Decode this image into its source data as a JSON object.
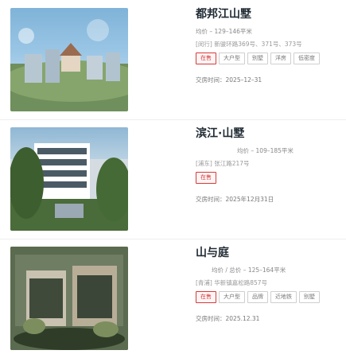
{
  "listings": [
    {
      "title": "都邦江山墅",
      "price_label": "均价",
      "price_value": "– 129–146平米",
      "address": "[闵行] 新骏环路369号、371号、373号",
      "tags": [
        "在售",
        "大户型",
        "别墅",
        "洋房",
        "低密度"
      ],
      "delivery": "交房时间：2025–12–31"
    },
    {
      "title": "滨江·山墅",
      "price_label": "均价",
      "price_value": "– 109–185平米",
      "address": "[浦东] 张江路217号",
      "tags": [
        "在售"
      ],
      "delivery": "交房时间：2025年12月31日"
    },
    {
      "title": "山与庭",
      "price_label": "均价 / 总价",
      "price_value": "– 125–164平米",
      "address": "[青浦] 华新镇嘉松路857号",
      "tags": [
        "在售",
        "大户型",
        "品牌",
        "近地铁",
        "别墅"
      ],
      "delivery": "交房时间：2025.12.31"
    }
  ]
}
